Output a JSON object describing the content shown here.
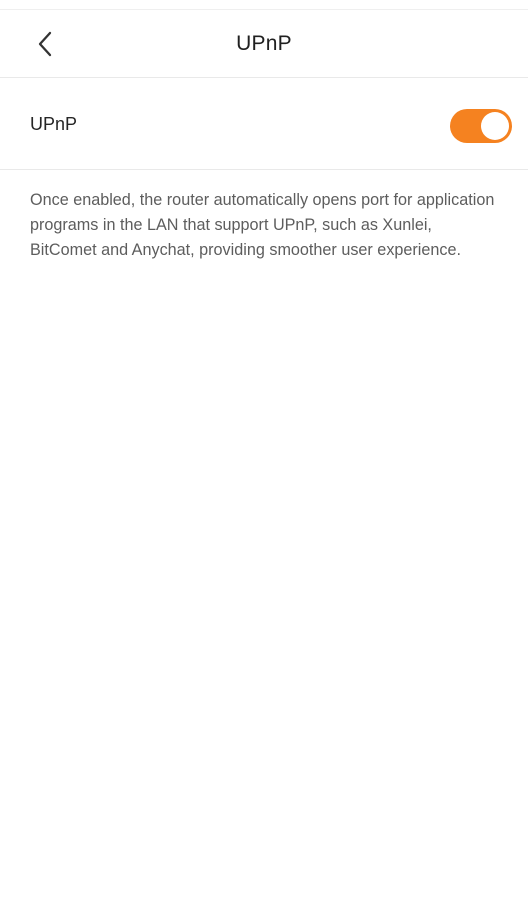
{
  "header": {
    "title": "UPnP",
    "back_icon": "chevron-left-icon"
  },
  "setting": {
    "label": "UPnP",
    "enabled": true
  },
  "description": "Once enabled, the router automatically opens port for application programs in the LAN that support UPnP, such as Xunlei, BitComet and Anychat, providing smoother user experience.",
  "colors": {
    "accent": "#f58220",
    "divider": "#e9e9e9",
    "text": "#262626",
    "secondary_text": "#5d5d5d"
  }
}
